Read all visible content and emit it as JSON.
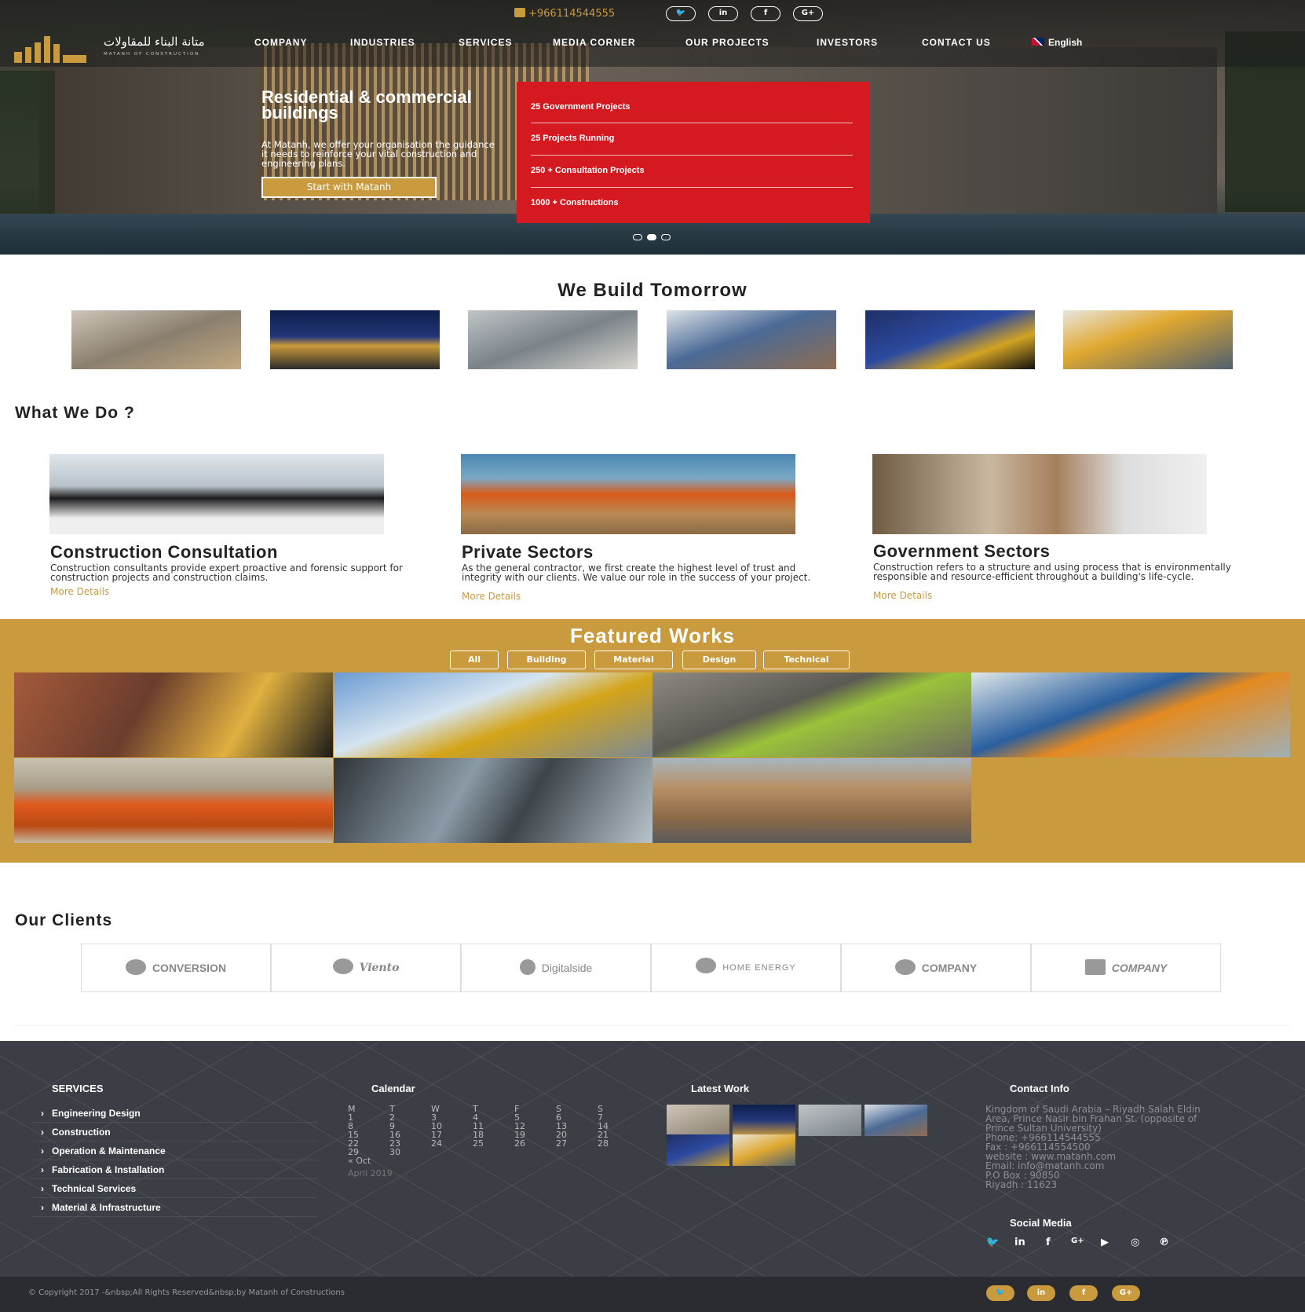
{
  "topbar": {
    "phone": "+966114544555",
    "social": [
      "twitter-icon",
      "linkedin-icon",
      "facebook-icon",
      "google-plus-icon"
    ],
    "social_glyphs": [
      "🐦",
      "in",
      "f",
      "G+"
    ]
  },
  "logo": {
    "arabic": "متانة البناء للمقاولات",
    "english": "MATANH OF CONSTRUCTION"
  },
  "nav": {
    "items": [
      "COMPANY",
      "INDUSTRIES",
      "SERVICES",
      "MEDIA CORNER",
      "OUR PROJECTS",
      "INVESTORS",
      "CONTACT US"
    ],
    "language": "English"
  },
  "hero": {
    "title": "Residential & commercial buildings",
    "description": "At Matanh, we offer your organisation the guidance it needs to reinforce your vital construction and engineering plans.",
    "cta": "Start with Matanh",
    "stats": [
      "25 Government Projects",
      "25 Projects Running",
      "250 + Consultation Projects",
      "1000 + Constructions"
    ],
    "slide_count": 3,
    "active_slide": 2
  },
  "build": {
    "title": "We Build Tomorrow"
  },
  "whatwedo": {
    "title": "What We Do ?",
    "cards": [
      {
        "title": "Construction Consultation",
        "desc": "Construction consultants provide expert proactive and forensic support for construction projects and construction claims.",
        "more": "More Details"
      },
      {
        "title": "Private Sectors",
        "desc": "As the general contractor, we first create the highest level of trust and integrity with our clients. We value our role in the success of your project.",
        "more": "More Details"
      },
      {
        "title": "Government Sectors",
        "desc": "Construction refers to a structure and using process that is environmentally responsible and resource-efficient throughout a building's life-cycle.",
        "more": "More Details"
      }
    ]
  },
  "featured": {
    "title": "Featured Works",
    "filters": [
      "All",
      "Building",
      "Material",
      "Design",
      "Technical"
    ]
  },
  "clients": {
    "title": "Our Clients",
    "logos": [
      "CONVERSION",
      "Viento",
      "Digitalside",
      "HOME ENERGY",
      "COMPANY",
      "COMPANY"
    ]
  },
  "footer": {
    "services_title": "SERVICES",
    "services": [
      "Engineering Design",
      "Construction",
      "Operation & Maintenance",
      "Fabrication & Installation",
      "Technical Services",
      "Material & Infrastructure"
    ],
    "calendar_title": "Calendar",
    "calendar": {
      "days": [
        "M",
        "T",
        "W",
        "T",
        "F",
        "S",
        "S"
      ],
      "weeks": [
        [
          "1",
          "2",
          "3",
          "4",
          "5",
          "6",
          "7"
        ],
        [
          "8",
          "9",
          "10",
          "11",
          "12",
          "13",
          "14"
        ],
        [
          "15",
          "16",
          "17",
          "18",
          "19",
          "20",
          "21"
        ],
        [
          "22",
          "23",
          "24",
          "25",
          "26",
          "27",
          "28"
        ],
        [
          "29",
          "30",
          "",
          "",
          "",
          "",
          ""
        ]
      ],
      "prev": "« Oct",
      "month": "April 2019"
    },
    "latest_title": "Latest Work",
    "contact_title": "Contact Info",
    "contact": [
      "Kingdom of Saudi Arabia – Riyadh Salah Eldin",
      "Area, Prince Nasir bin Frahan St. (opposite of",
      "Prince Sultan University)",
      "Phone: +966114544555",
      "Fax : +966114554500",
      "website : www.matanh.com",
      "Email: info@matanh.com",
      "P.O Box : 90850",
      "Riyadh : 11623"
    ],
    "social_title": "Social Media",
    "social": [
      "🐦",
      "in",
      "f",
      "G+",
      "▶",
      "◎",
      "℗"
    ],
    "copyright": "© Copyright 2017 -&nbsp;All Rights Reserved&nbsp;by Matanh of Constructions",
    "bottom_social": [
      "🐦",
      "in",
      "f",
      "G+"
    ]
  },
  "colors": {
    "gold": "#c99a3e",
    "red": "#d41920",
    "footer": "#3c3e45"
  }
}
